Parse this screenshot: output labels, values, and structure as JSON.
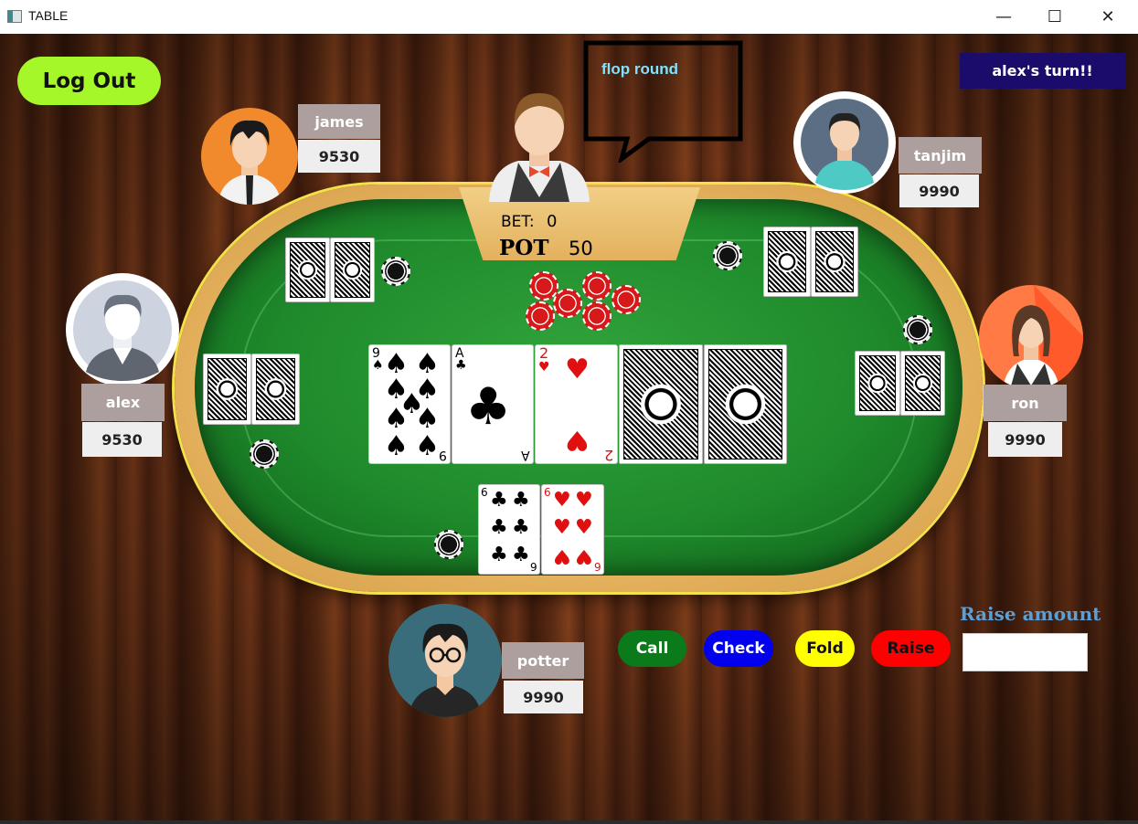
{
  "window": {
    "title": "TABLE",
    "minimize_glyph": "—",
    "maximize_glyph": "☐",
    "close_glyph": "✕"
  },
  "controls": {
    "logout_label": "Log Out",
    "turn_banner": "alex's turn!!"
  },
  "dealer": {
    "speech": "flop round",
    "bet_label": "BET:",
    "bet_value": "0",
    "pot_label": "POT",
    "pot_value": "50"
  },
  "players": {
    "james": {
      "name": "james",
      "stack": "9530"
    },
    "tanjim": {
      "name": "tanjim",
      "stack": "9990"
    },
    "alex": {
      "name": "alex",
      "stack": "9530"
    },
    "ron": {
      "name": "ron",
      "stack": "9990"
    },
    "potter": {
      "name": "potter",
      "stack": "9990"
    }
  },
  "community_cards": [
    {
      "rank": "9",
      "suit": "♠",
      "color": "black"
    },
    {
      "rank": "A",
      "suit": "♣",
      "color": "black"
    },
    {
      "rank": "2",
      "suit": "♥",
      "color": "red"
    },
    {
      "rank": "",
      "suit": "",
      "color": "back"
    },
    {
      "rank": "",
      "suit": "",
      "color": "back"
    }
  ],
  "hero_cards": [
    {
      "rank": "6",
      "suit": "♣",
      "color": "black"
    },
    {
      "rank": "6",
      "suit": "♥",
      "color": "red"
    }
  ],
  "actions": {
    "call": "Call",
    "check": "Check",
    "fold": "Fold",
    "raise": "Raise",
    "raise_amount_label": "Raise amount",
    "raise_amount_value": ""
  },
  "colors": {
    "call_bg": "#0a7a1a",
    "check_bg": "#0000ee",
    "fold_bg": "#ffff00",
    "raise_bg": "#ff0000",
    "logout_bg": "#a6f72a",
    "turn_bg": "#1b0c6b",
    "speech_text": "#7fe3ff",
    "raise_label_text": "#5aa0d8"
  }
}
